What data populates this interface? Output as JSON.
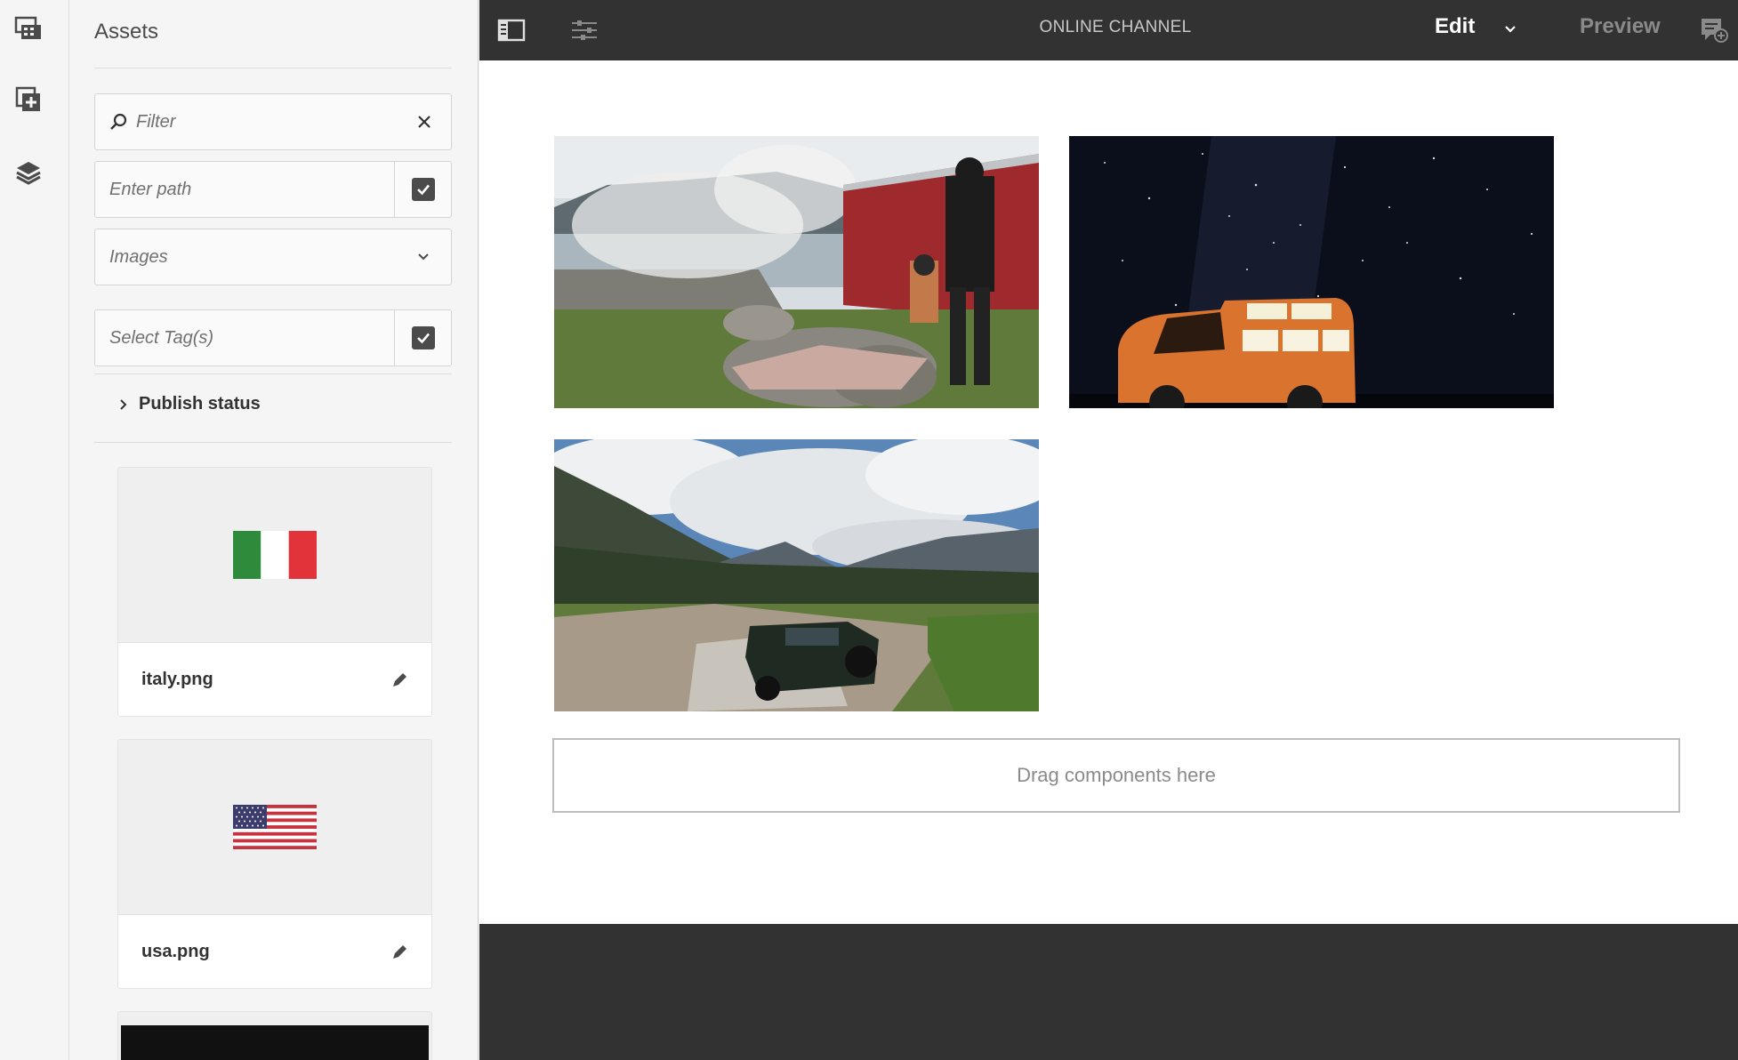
{
  "rail": {
    "items": [
      {
        "icon": "assets-icon"
      },
      {
        "icon": "components-icon"
      },
      {
        "icon": "content-tree-icon"
      }
    ]
  },
  "panel": {
    "title": "Assets",
    "filter": {
      "placeholder": "Filter"
    },
    "path": {
      "placeholder": "Enter path"
    },
    "type_select": {
      "selected": "Images"
    },
    "tags": {
      "placeholder": "Select Tag(s)"
    },
    "publish_status": {
      "label": "Publish status"
    },
    "assets": [
      {
        "name": "italy.png"
      },
      {
        "name": "usa.png"
      }
    ]
  },
  "toolbar": {
    "title": "ONLINE CHANNEL",
    "edit_label": "Edit",
    "preview_label": "Preview"
  },
  "canvas": {
    "images": [
      {
        "subject": "campfire-by-lake"
      },
      {
        "subject": "van-under-night-sky"
      },
      {
        "subject": "suv-crossing-river"
      }
    ],
    "dropzone_label": "Drag components here"
  },
  "colors": {
    "toolbar_bg": "#323232",
    "panel_bg": "#f5f5f5",
    "canvas_bg": "#ffffff"
  }
}
